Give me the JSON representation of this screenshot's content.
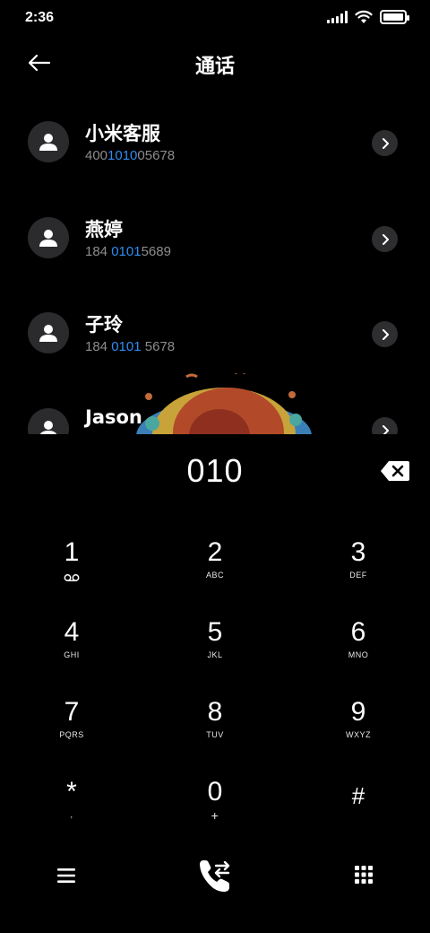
{
  "status_bar": {
    "time": "2:36"
  },
  "header": {
    "title": "通话"
  },
  "contacts": [
    {
      "name": "小米客服",
      "number_parts": [
        "400",
        "1010",
        "05678"
      ]
    },
    {
      "name": "燕婷",
      "number_parts": [
        "184 ",
        "0101",
        "5689"
      ]
    },
    {
      "name": "子玲",
      "number_parts": [
        "184 ",
        "0101",
        " 5678"
      ]
    },
    {
      "name": "Jason",
      "number_parts": [
        "",
        "",
        ""
      ]
    }
  ],
  "dial_entry": {
    "digits": "010"
  },
  "keypad": {
    "keys": [
      {
        "digit": "1",
        "letters": ""
      },
      {
        "digit": "2",
        "letters": "ABC"
      },
      {
        "digit": "3",
        "letters": "DEF"
      },
      {
        "digit": "4",
        "letters": "GHI"
      },
      {
        "digit": "5",
        "letters": "JKL"
      },
      {
        "digit": "6",
        "letters": "MNO"
      },
      {
        "digit": "7",
        "letters": "PQRS"
      },
      {
        "digit": "8",
        "letters": "TUV"
      },
      {
        "digit": "9",
        "letters": "WXYZ"
      },
      {
        "digit": "*",
        "letters": ","
      },
      {
        "digit": "0",
        "letters": "+"
      },
      {
        "digit": "#",
        "letters": ""
      }
    ]
  },
  "icons": {
    "back": "arrow-left-icon",
    "detail": "chevron-right-icon",
    "avatar": "person-icon",
    "backspace": "backspace-icon",
    "voicemail": "voicemail-icon",
    "menu": "menu-icon",
    "call": "call-switch-icon",
    "dialpad": "dialpad-icon"
  },
  "colors": {
    "background": "#000000",
    "highlight": "#2f8cf3",
    "secondary_text": "#8d8d8f",
    "avatar_bg": "#2b2b2d"
  }
}
